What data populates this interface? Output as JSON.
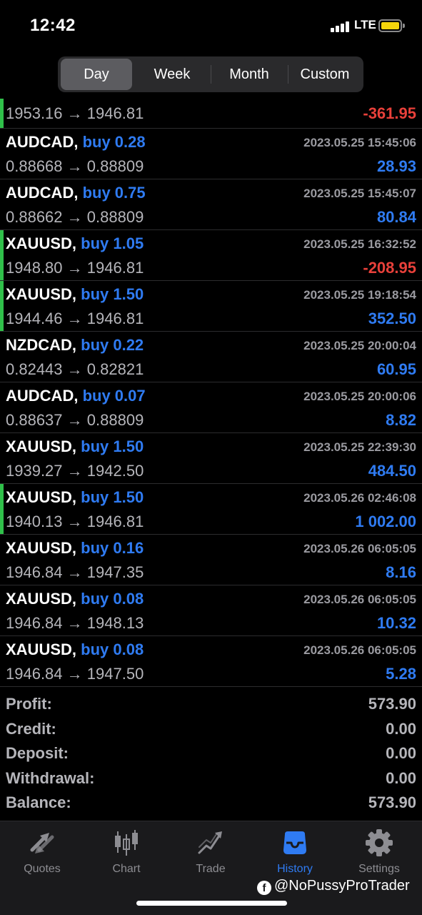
{
  "status": {
    "time": "12:42",
    "network": "LTE"
  },
  "periods": [
    "Day",
    "Week",
    "Month",
    "Custom"
  ],
  "active_period": "Day",
  "deals": [
    {
      "symbol": "",
      "side": "",
      "time": "",
      "open": "1953.16",
      "close": "1946.81",
      "profit": "-361.95",
      "negative": true,
      "indicator": true,
      "partial": true
    },
    {
      "symbol": "AUDCAD,",
      "side": "buy 0.28",
      "time": "2023.05.25 15:45:06",
      "open": "0.88668",
      "close": "0.88809",
      "profit": "28.93",
      "negative": false,
      "indicator": false
    },
    {
      "symbol": "AUDCAD,",
      "side": "buy 0.75",
      "time": "2023.05.25 15:45:07",
      "open": "0.88662",
      "close": "0.88809",
      "profit": "80.84",
      "negative": false,
      "indicator": false
    },
    {
      "symbol": "XAUUSD,",
      "side": "buy 1.05",
      "time": "2023.05.25 16:32:52",
      "open": "1948.80",
      "close": "1946.81",
      "profit": "-208.95",
      "negative": true,
      "indicator": true
    },
    {
      "symbol": "XAUUSD,",
      "side": "buy 1.50",
      "time": "2023.05.25 19:18:54",
      "open": "1944.46",
      "close": "1946.81",
      "profit": "352.50",
      "negative": false,
      "indicator": true
    },
    {
      "symbol": "NZDCAD,",
      "side": "buy 0.22",
      "time": "2023.05.25 20:00:04",
      "open": "0.82443",
      "close": "0.82821",
      "profit": "60.95",
      "negative": false,
      "indicator": false
    },
    {
      "symbol": "AUDCAD,",
      "side": "buy 0.07",
      "time": "2023.05.25 20:00:06",
      "open": "0.88637",
      "close": "0.88809",
      "profit": "8.82",
      "negative": false,
      "indicator": false
    },
    {
      "symbol": "XAUUSD,",
      "side": "buy 1.50",
      "time": "2023.05.25 22:39:30",
      "open": "1939.27",
      "close": "1942.50",
      "profit": "484.50",
      "negative": false,
      "indicator": false
    },
    {
      "symbol": "XAUUSD,",
      "side": "buy 1.50",
      "time": "2023.05.26 02:46:08",
      "open": "1940.13",
      "close": "1946.81",
      "profit": "1 002.00",
      "negative": false,
      "indicator": true
    },
    {
      "symbol": "XAUUSD,",
      "side": "buy 0.16",
      "time": "2023.05.26 06:05:05",
      "open": "1946.84",
      "close": "1947.35",
      "profit": "8.16",
      "negative": false,
      "indicator": false
    },
    {
      "symbol": "XAUUSD,",
      "side": "buy 0.08",
      "time": "2023.05.26 06:05:05",
      "open": "1946.84",
      "close": "1948.13",
      "profit": "10.32",
      "negative": false,
      "indicator": false
    },
    {
      "symbol": "XAUUSD,",
      "side": "buy 0.08",
      "time": "2023.05.26 06:05:05",
      "open": "1946.84",
      "close": "1947.50",
      "profit": "5.28",
      "negative": false,
      "indicator": false
    }
  ],
  "arrow": "→",
  "summary": [
    {
      "label": "Profit:",
      "value": "573.90"
    },
    {
      "label": "Credit:",
      "value": "0.00"
    },
    {
      "label": "Deposit:",
      "value": "0.00"
    },
    {
      "label": "Withdrawal:",
      "value": "0.00"
    },
    {
      "label": "Balance:",
      "value": "573.90"
    }
  ],
  "tabs": [
    {
      "label": "Quotes",
      "icon": "quotes-icon"
    },
    {
      "label": "Chart",
      "icon": "chart-icon"
    },
    {
      "label": "Trade",
      "icon": "trade-icon"
    },
    {
      "label": "History",
      "icon": "history-icon"
    },
    {
      "label": "Settings",
      "icon": "settings-icon"
    }
  ],
  "active_tab": "History",
  "watermark": "@NoPussyProTrader",
  "colors": {
    "positive": "#2f7bf2",
    "negative": "#e8403a",
    "indicator": "#30c04a",
    "active_tab": "#2f7bf2"
  }
}
